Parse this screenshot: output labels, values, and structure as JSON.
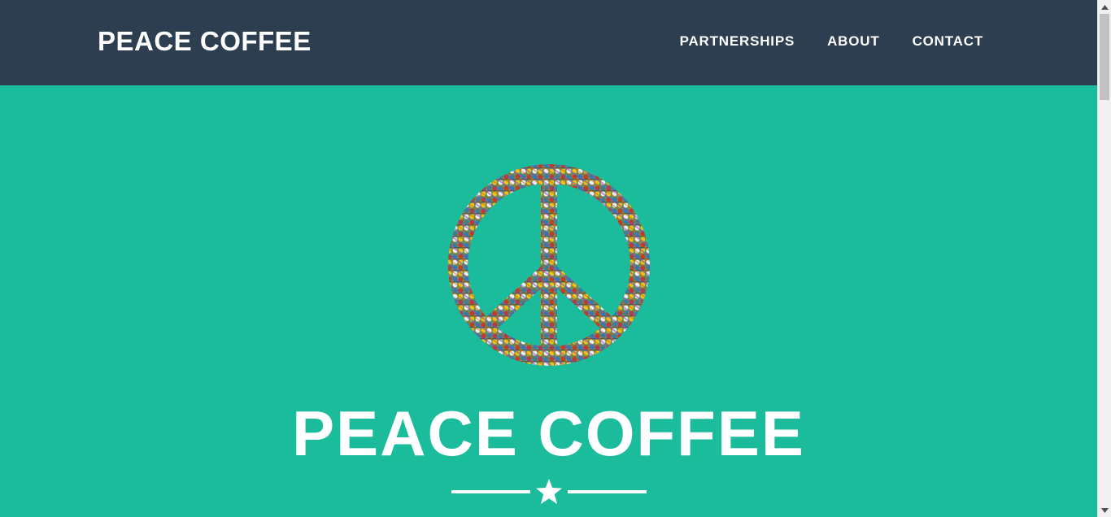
{
  "navbar": {
    "brand": "PEACE COFFEE",
    "links": [
      {
        "label": "PARTNERSHIPS"
      },
      {
        "label": "ABOUT"
      },
      {
        "label": "CONTACT"
      }
    ]
  },
  "masthead": {
    "image_icon": "peace-sign-icon",
    "title": "PEACE COFFEE",
    "divider_icon": "star-icon"
  },
  "colors": {
    "navbar_bg": "#2c3e50",
    "hero_bg": "#1abc9c",
    "text": "#ffffff"
  }
}
